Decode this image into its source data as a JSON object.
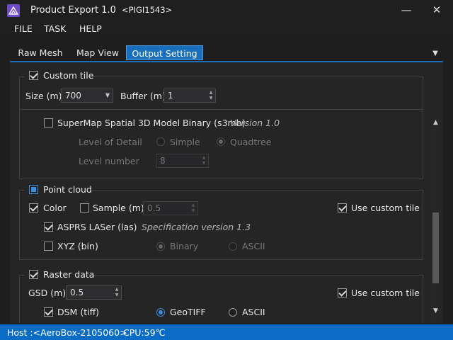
{
  "window": {
    "app_title": "Product Export 1.0",
    "host_tag": "<PIGI1543>",
    "minimize_glyph": "—",
    "close_glyph": "✕"
  },
  "menu": [
    "FILE",
    "TASK",
    "HELP"
  ],
  "tabs": [
    {
      "label": "Raw Mesh",
      "active": false
    },
    {
      "label": "Map View",
      "active": false
    },
    {
      "label": "Output Setting",
      "active": true
    }
  ],
  "custom_tile": {
    "label": "Custom tile",
    "checked": true,
    "size_label": "Size (m)",
    "size_value": "700",
    "buffer_label": "Buffer (m)",
    "buffer_value": "1"
  },
  "s3mb": {
    "label": "SuperMap Spatial 3D Model Binary (s3mb)",
    "version": "Version 1.0",
    "checked": false,
    "lod_label": "Level of Detail",
    "lod_options": [
      "Simple",
      "Quadtree"
    ],
    "lod_selected": "Quadtree",
    "level_number_label": "Level number",
    "level_number_value": "8"
  },
  "point_cloud": {
    "label": "Point cloud",
    "color_label": "Color",
    "color_checked": true,
    "sample_label": "Sample (m)",
    "sample_checked": false,
    "sample_value": "0.5",
    "use_custom_tile_label": "Use custom tile",
    "use_custom_tile_checked": true,
    "las_label": "ASPRS LASer (las)",
    "las_checked": true,
    "las_spec": "Specification version 1.3",
    "xyz_label": "XYZ (bin)",
    "xyz_checked": false,
    "xyz_options": [
      "Binary",
      "ASCII"
    ],
    "xyz_selected": "Binary"
  },
  "raster": {
    "label": "Raster data",
    "checked": true,
    "gsd_label": "GSD (m)",
    "gsd_value": "0.5",
    "use_custom_tile_label": "Use custom tile",
    "use_custom_tile_checked": true,
    "dsm_label": "DSM (tiff)",
    "dsm_checked": true,
    "dsm_options": [
      "GeoTIFF",
      "ASCII"
    ],
    "dsm_selected": "GeoTIFF"
  },
  "status": {
    "host": "Host :<AeroBox-2105060>",
    "cpu": "CPU:59℃"
  },
  "colors": {
    "accent": "#1a6fbd",
    "statusbar": "#0b6cc5",
    "background": "#1e1e1e"
  }
}
